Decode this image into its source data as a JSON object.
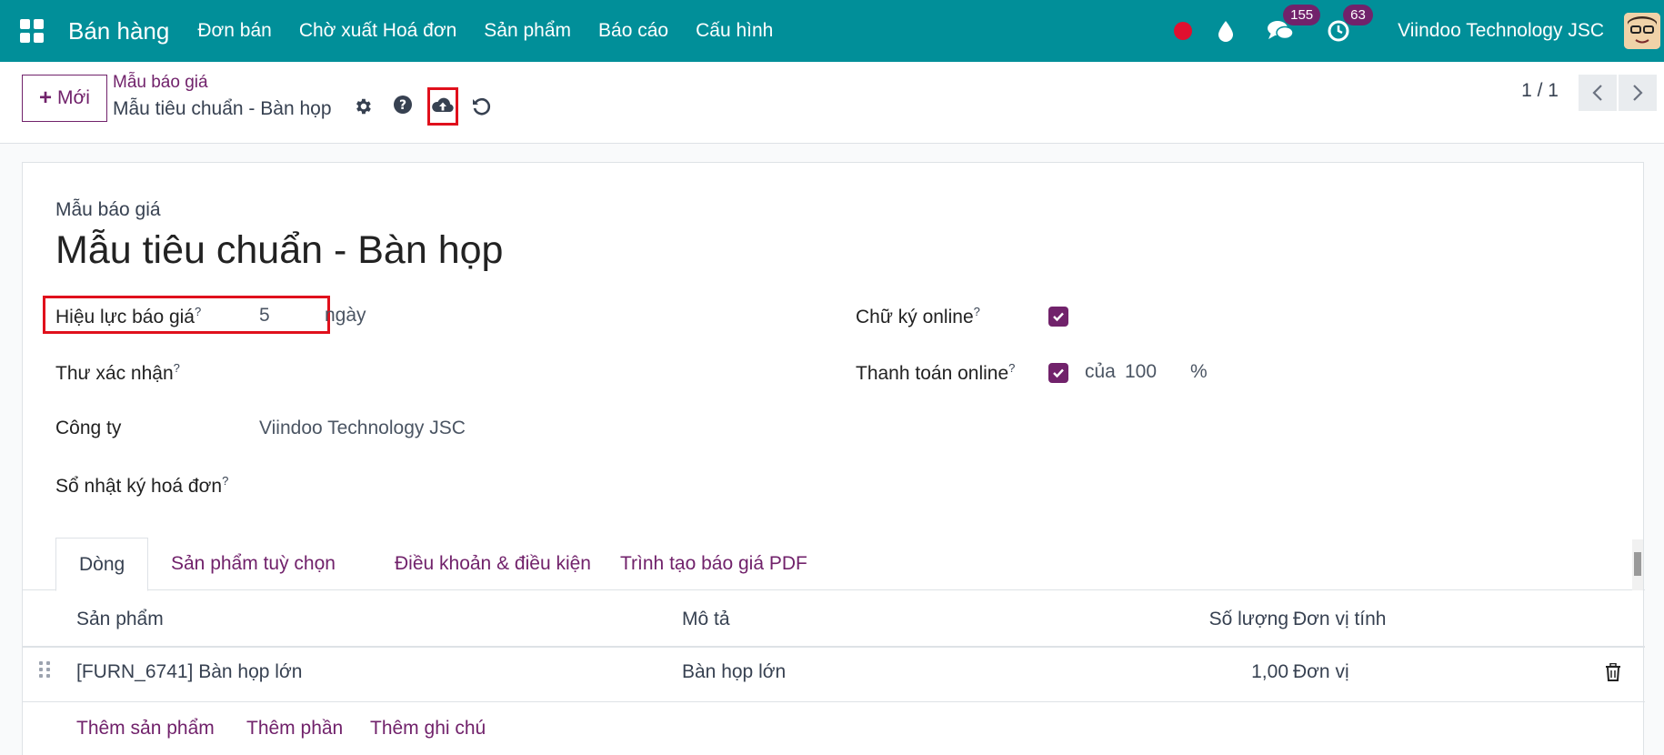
{
  "navbar": {
    "brand": "Bán hàng",
    "menu": [
      "Đơn bán",
      "Chờ xuất Hoá đơn",
      "Sản phẩm",
      "Báo cáo",
      "Cấu hình"
    ],
    "messages_count": "155",
    "activities_count": "63",
    "company": "Viindoo Technology JSC",
    "bg_color": "#018f99"
  },
  "control_panel": {
    "new_label": "Mới",
    "breadcrumb_parent": "Mẫu báo giá",
    "breadcrumb_current": "Mẫu tiêu chuẩn - Bàn họp",
    "pager": "1 / 1"
  },
  "form": {
    "model_label": "Mẫu báo giá",
    "title": "Mẫu tiêu chuẩn - Bàn họp",
    "validity_label": "Hiệu lực báo giá",
    "validity_value": "5",
    "validity_unit": "ngày",
    "confirmation_mail_label": "Thư xác nhận",
    "company_label": "Công ty",
    "company_value": "Viindoo Technology JSC",
    "journal_label": "Sổ nhật ký hoá đơn",
    "signature_label": "Chữ ký online",
    "signature_checked": true,
    "payment_label": "Thanh toán online",
    "payment_checked": true,
    "payment_of": "của",
    "payment_percent": "100",
    "payment_percent_sign": "%",
    "help_mark": "?"
  },
  "tabs": [
    "Dòng",
    "Sản phẩm tuỳ chọn",
    "Điều khoản & điều kiện",
    "Trình tạo báo giá PDF"
  ],
  "lines_table": {
    "columns": [
      "Sản phẩm",
      "Mô tả",
      "Số lượng",
      "Đơn vị tính"
    ],
    "rows": [
      {
        "product": "[FURN_6741] Bàn họp lớn",
        "description": "Bàn họp lớn",
        "quantity": "1,00",
        "uom": "Đơn vị"
      }
    ],
    "add_product": "Thêm sản phẩm",
    "add_section": "Thêm phần",
    "add_note": "Thêm ghi chú"
  }
}
